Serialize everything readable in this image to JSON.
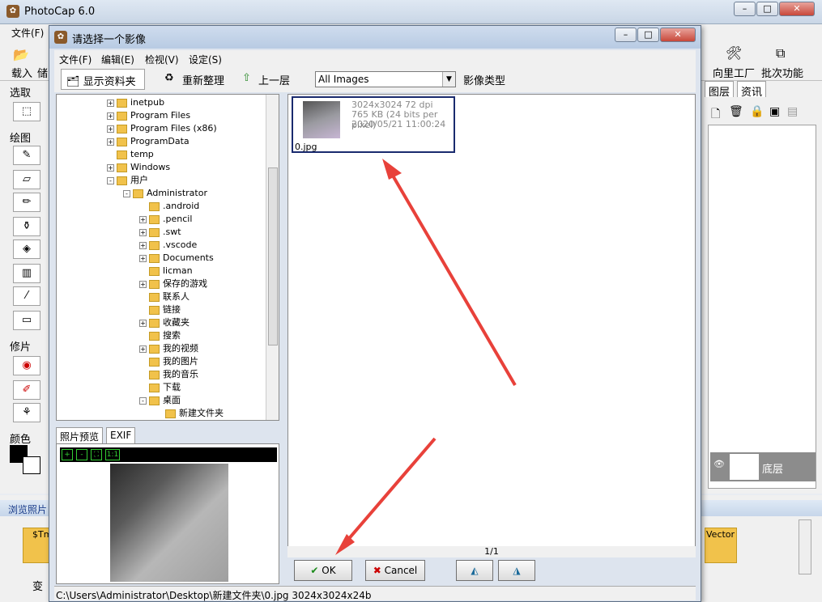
{
  "main": {
    "title": "PhotoCap 6.0",
    "menu_file": "文件(F)",
    "toolbar": {
      "load": "载入",
      "save_partial": "储",
      "wizard": "向里工厂",
      "batch": "批次功能"
    },
    "left_sections": {
      "select": "选取",
      "draw": "绘图",
      "retouch": "修片",
      "color": "颜色"
    },
    "right_tabs": [
      "图层",
      "资讯"
    ],
    "layer_name": "底层",
    "browse_label": "浏览照片",
    "thumb_left": "$Tmi",
    "thumb_right": "Vector",
    "bottom_label": "变"
  },
  "dialog": {
    "title": "请选择一个影像",
    "menu": [
      "文件(F)",
      "编辑(E)",
      "检视(V)",
      "设定(S)"
    ],
    "toolbar": {
      "show_folder": "显示资料夹",
      "refresh": "重新整理",
      "up_level": "上一层",
      "filter_value": "All Images",
      "filter_label": "影像类型"
    },
    "tree": [
      {
        "label": "inetpub",
        "level": 0,
        "exp": "+"
      },
      {
        "label": "Program Files",
        "level": 0,
        "exp": "+"
      },
      {
        "label": "Program Files (x86)",
        "level": 0,
        "exp": "+"
      },
      {
        "label": "ProgramData",
        "level": 0,
        "exp": "+"
      },
      {
        "label": "temp",
        "level": 0,
        "exp": ""
      },
      {
        "label": "Windows",
        "level": 0,
        "exp": "+"
      },
      {
        "label": "用户",
        "level": 0,
        "exp": "-"
      },
      {
        "label": "Administrator",
        "level": 1,
        "exp": "-"
      },
      {
        "label": ".android",
        "level": 2,
        "exp": ""
      },
      {
        "label": ".pencil",
        "level": 2,
        "exp": "+"
      },
      {
        "label": ".swt",
        "level": 2,
        "exp": "+"
      },
      {
        "label": ".vscode",
        "level": 2,
        "exp": "+"
      },
      {
        "label": "Documents",
        "level": 2,
        "exp": "+"
      },
      {
        "label": "licman",
        "level": 2,
        "exp": ""
      },
      {
        "label": "保存的游戏",
        "level": 2,
        "exp": "+"
      },
      {
        "label": "联系人",
        "level": 2,
        "exp": ""
      },
      {
        "label": "链接",
        "level": 2,
        "exp": ""
      },
      {
        "label": "收藏夹",
        "level": 2,
        "exp": "+"
      },
      {
        "label": "搜索",
        "level": 2,
        "exp": ""
      },
      {
        "label": "我的视频",
        "level": 2,
        "exp": "+"
      },
      {
        "label": "我的图片",
        "level": 2,
        "exp": ""
      },
      {
        "label": "我的音乐",
        "level": 2,
        "exp": ""
      },
      {
        "label": "下载",
        "level": 2,
        "exp": ""
      },
      {
        "label": "桌面",
        "level": 2,
        "exp": "-"
      },
      {
        "label": "新建文件夹",
        "level": 3,
        "exp": ""
      }
    ],
    "preview_tabs": [
      "照片预览",
      "EXIF"
    ],
    "zoom_buttons": [
      "+",
      "-",
      "⛶",
      "1:1"
    ],
    "file": {
      "dims": "3024x3024 72 dpi",
      "size": "765 KB (24 bits per pixel)",
      "date": "2020/05/21 11:00:24",
      "name": "0.jpg"
    },
    "page": "1/1",
    "ok": "OK",
    "cancel": "Cancel",
    "status": "C:\\Users\\Administrator\\Desktop\\新建文件夹\\0.jpg    3024x3024x24b"
  },
  "colors": {
    "selection_border": "#1a2a6e",
    "arrow": "#e8413a"
  }
}
